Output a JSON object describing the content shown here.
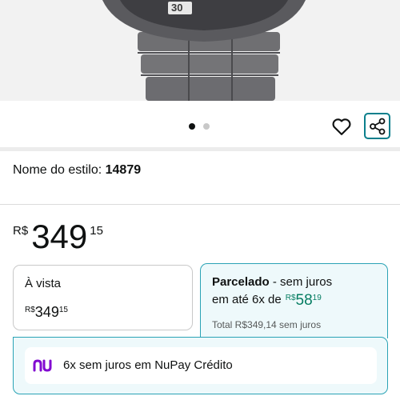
{
  "gallery": {
    "dots": 2,
    "active_dot": 0,
    "watch_dial_number": "30"
  },
  "icons": {
    "heart": "heart-icon",
    "share": "share-icon",
    "nupay": "nu-logo"
  },
  "colors": {
    "accent_teal": "#2aa3b5",
    "price_green": "#067d62",
    "nu_purple": "#820ad1"
  },
  "style": {
    "label": "Nome do estilo:",
    "value": "14879"
  },
  "price": {
    "currency": "R$",
    "whole": "349",
    "cents": "15"
  },
  "options": {
    "avista": {
      "label": "À vista",
      "currency": "R$",
      "whole": "349",
      "cents": "15"
    },
    "parcelado": {
      "title": "Parcelado",
      "title_suffix": " - sem juros",
      "installments_prefix": "em até 6x de",
      "currency": "R$",
      "whole": "58",
      "cents": "19",
      "total_text": "Total R$349,14  sem juros"
    }
  },
  "nupay": {
    "text": "6x sem juros em NuPay Crédito"
  }
}
